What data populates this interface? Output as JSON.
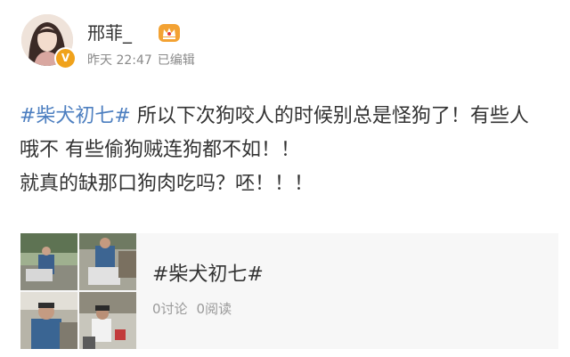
{
  "author": {
    "name": "邢菲_",
    "time": "昨天 22:47",
    "edited": "已编辑",
    "verified_badge": "V",
    "avatar_icon": "avatar",
    "vip_icon": "crown-badge-icon"
  },
  "post": {
    "topic": "#柴犬初七#",
    "text_after_topic": " 所以下次狗咬人的时候别总是怪狗了！有些人 哦不 有些偷狗贼连狗都不如！！",
    "text_line3": "就真的缺那口狗肉吃吗？呸！！！"
  },
  "topic_card": {
    "title": "#柴犬初七#",
    "discussions": "0讨论",
    "reads": "0阅读"
  },
  "colors": {
    "topic_link": "#4d7fc0",
    "text": "#333333",
    "meta": "#8a8a8a",
    "card_bg": "#f7f7f7",
    "verified": "#f0a21b"
  }
}
